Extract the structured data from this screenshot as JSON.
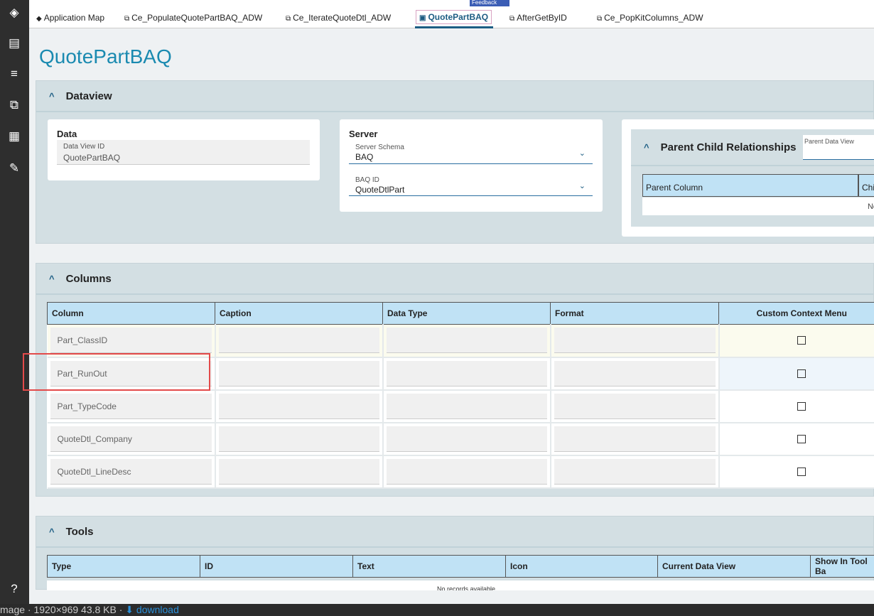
{
  "tabs": [
    {
      "label": "Application Map",
      "icon": "layers-icon"
    },
    {
      "label": "Ce_PopulateQuotePartBAQ_ADW",
      "icon": "widget-icon"
    },
    {
      "label": "Ce_IterateQuoteDtl_ADW",
      "icon": "widget-icon"
    },
    {
      "label": "QuotePartBAQ",
      "icon": "dataview-icon",
      "active": true
    },
    {
      "label": "AfterGetByID",
      "icon": "widget-icon"
    },
    {
      "label": "Ce_PopKitColumns_ADW",
      "icon": "widget-icon"
    }
  ],
  "feedback": "Feedback",
  "page_title": "QuotePartBAQ",
  "dataview": {
    "title": "Dataview",
    "data": {
      "title": "Data",
      "id_label": "Data View ID",
      "id_value": "QuotePartBAQ"
    },
    "server": {
      "title": "Server",
      "schema_label": "Server Schema",
      "schema_value": "BAQ",
      "baq_label": "BAQ ID",
      "baq_value": "QuoteDtlPart"
    },
    "relationships": {
      "title": "Parent Child Relationships",
      "parent_dv_label": "Parent Data View",
      "columns": [
        "Parent Column",
        "Chi"
      ],
      "empty": "No"
    }
  },
  "columns": {
    "title": "Columns",
    "headers": [
      "Column",
      "Caption",
      "Data Type",
      "Format",
      "Custom Context Menu"
    ],
    "rows": [
      {
        "column": "Part_ClassID",
        "checked": false
      },
      {
        "column": "Part_RunOut",
        "checked": false
      },
      {
        "column": "Part_TypeCode",
        "checked": false
      },
      {
        "column": "QuoteDtl_Company",
        "checked": false
      },
      {
        "column": "QuoteDtl_LineDesc",
        "checked": false
      }
    ]
  },
  "tools": {
    "title": "Tools",
    "headers": [
      "Type",
      "ID",
      "Text",
      "Icon",
      "Current Data View",
      "Show In Tool Ba"
    ],
    "empty": "No records available"
  },
  "statusbar": {
    "text": "mage · 1920×969 43.8 KB · ",
    "download": "download"
  }
}
